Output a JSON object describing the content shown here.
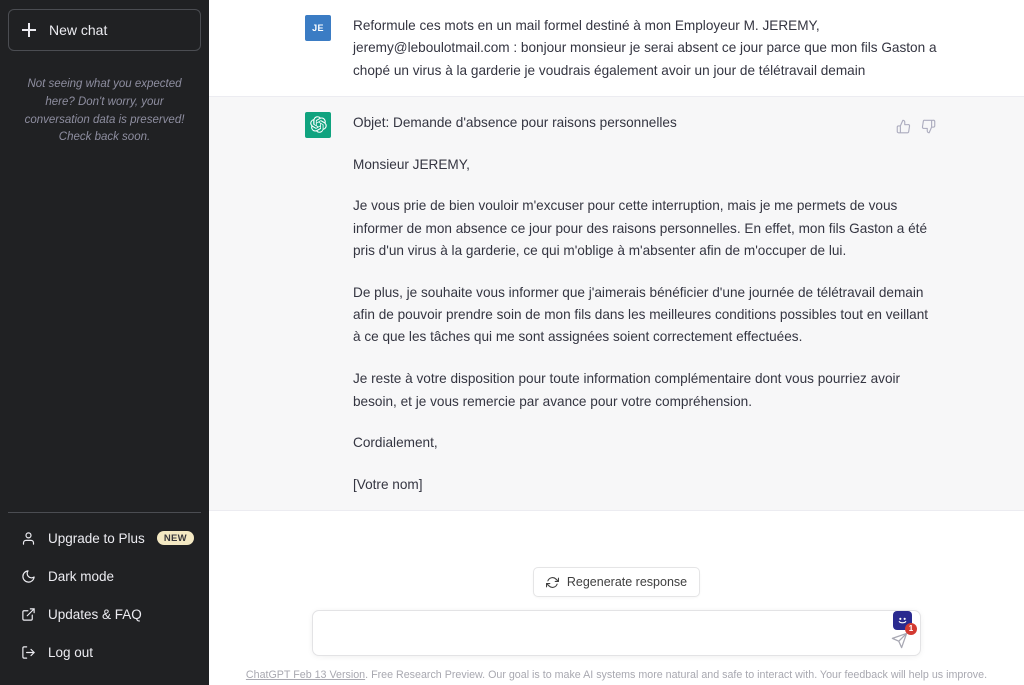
{
  "sidebar": {
    "new_chat_label": "New chat",
    "note": "Not seeing what you expected here? Don't worry, your conversation data is preserved! Check back soon.",
    "items": [
      {
        "label": "Upgrade to Plus",
        "icon": "person-icon",
        "badge": "NEW"
      },
      {
        "label": "Dark mode",
        "icon": "moon-icon",
        "badge": ""
      },
      {
        "label": "Updates & FAQ",
        "icon": "external-link-icon",
        "badge": ""
      },
      {
        "label": "Log out",
        "icon": "logout-icon",
        "badge": ""
      }
    ]
  },
  "conversation": {
    "messages": [
      {
        "role": "user",
        "avatar_initials": "JE",
        "avatar_color": "#3b7cc4",
        "paragraphs": [
          "Reformule ces mots en un mail formel destiné à mon Employeur M. JEREMY, jeremy@leboulotmail.com : bonjour monsieur je serai absent ce jour parce que mon fils Gaston a chopé un virus à la garderie je voudrais également avoir un jour de télétravail demain"
        ]
      },
      {
        "role": "assistant",
        "avatar_color": "#10a37f",
        "paragraphs": [
          "Objet: Demande d'absence pour raisons personnelles",
          "Monsieur JEREMY,",
          "Je vous prie de bien vouloir m'excuser pour cette interruption, mais je me permets de vous informer de mon absence ce jour pour des raisons personnelles. En effet, mon fils Gaston a été pris d'un virus à la garderie, ce qui m'oblige à m'absenter afin de m'occuper de lui.",
          "De plus, je souhaite vous informer que j'aimerais bénéficier d'une journée de télétravail demain afin de pouvoir prendre soin de mon fils dans les meilleures conditions possibles tout en veillant à ce que les tâches qui me sont assignées soient correctement effectuées.",
          "Je reste à votre disposition pour toute information complémentaire dont vous pourriez avoir besoin, et je vous remercie par avance pour votre compréhension.",
          "Cordialement,",
          "[Votre nom]"
        ],
        "actions": [
          {
            "name": "thumbs-up-icon"
          },
          {
            "name": "thumbs-down-icon"
          }
        ]
      }
    ]
  },
  "composer": {
    "regenerate_label": "Regenerate response",
    "input_value": "",
    "input_placeholder": "",
    "send_icon": "send-icon",
    "extension_badge_count": "1"
  },
  "footer": {
    "version_link": "ChatGPT Feb 13 Version",
    "disclaimer": ". Free Research Preview. Our goal is to make AI systems more natural and safe to interact with. Your feedback will help us improve."
  },
  "theme": {
    "sidebar_bg": "#202123",
    "assistant_bg": "#f7f7f8",
    "user_bg": "#ffffff",
    "accent_green": "#10a37f",
    "badge_yellow": "#f4e9c3"
  }
}
